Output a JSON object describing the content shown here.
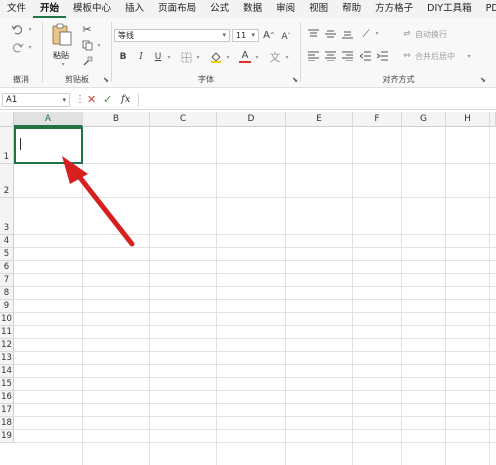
{
  "menu": [
    "文件",
    "开始",
    "模板中心",
    "插入",
    "页面布局",
    "公式",
    "数据",
    "审阅",
    "视图",
    "帮助",
    "方方格子",
    "DIY工具箱",
    "PDF工具"
  ],
  "active_menu": "开始",
  "ribbon": {
    "undo_group": {
      "label": "撤消"
    },
    "clipboard": {
      "paste_label": "粘贴",
      "label": "剪贴板"
    },
    "font": {
      "name": "等线",
      "size": "11",
      "label": "字体"
    },
    "alignment": {
      "label": "对齐方式",
      "wrap_text": "自动换行",
      "merge_center": "合并后居中"
    },
    "colors": {
      "accent": "#217346",
      "font_color": "#e03030",
      "arrow": "#d62020"
    }
  },
  "formula_bar": {
    "name_box": "A1",
    "fx": "fx",
    "formula": ""
  },
  "grid": {
    "columns": [
      "A",
      "B",
      "C",
      "D",
      "E",
      "F",
      "G",
      "H"
    ],
    "selected_column": "A",
    "rows": [
      "1",
      "2",
      "3",
      "4",
      "5",
      "6",
      "7",
      "8",
      "9",
      "10",
      "11",
      "12",
      "13",
      "14",
      "15",
      "16",
      "17",
      "18",
      "19"
    ],
    "active_cell": "A1"
  }
}
